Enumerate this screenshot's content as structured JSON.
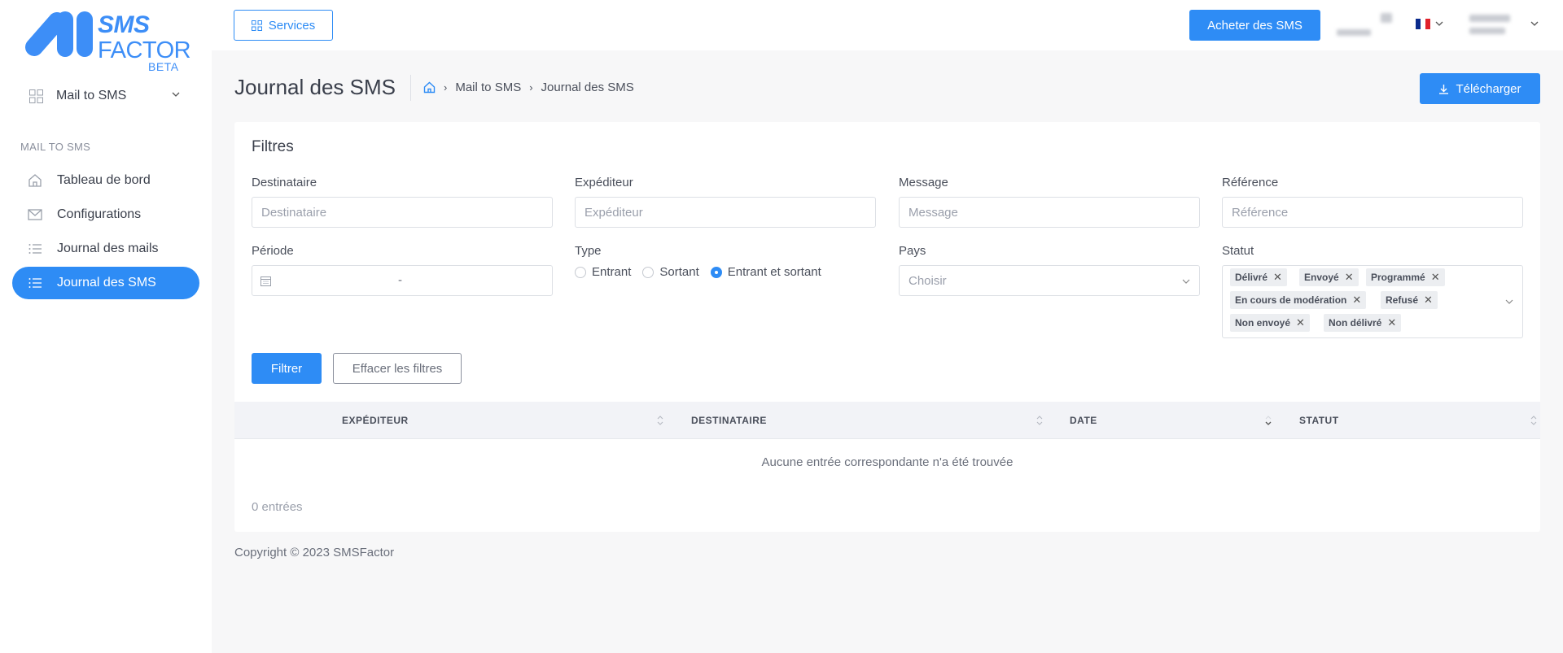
{
  "logo": {
    "line1": "SMS",
    "line2": "FACTOR",
    "line3": "BETA"
  },
  "sidebar": {
    "selector_label": "Mail to SMS",
    "section_label": "MAIL TO SMS",
    "items": [
      {
        "label": "Tableau de bord",
        "icon": "home-icon"
      },
      {
        "label": "Configurations",
        "icon": "envelope-icon"
      },
      {
        "label": "Journal des mails",
        "icon": "list-icon"
      },
      {
        "label": "Journal des SMS",
        "icon": "list-icon",
        "active": true
      }
    ]
  },
  "header": {
    "services_label": "Services",
    "buy_label": "Acheter des SMS",
    "language": "FR"
  },
  "page": {
    "title": "Journal des SMS",
    "breadcrumb": [
      "Mail to SMS",
      "Journal des SMS"
    ],
    "download_label": "Télécharger"
  },
  "filters": {
    "title": "Filtres",
    "destinataire": {
      "label": "Destinataire",
      "placeholder": "Destinataire"
    },
    "expediteur": {
      "label": "Expéditeur",
      "placeholder": "Expéditeur"
    },
    "message": {
      "label": "Message",
      "placeholder": "Message"
    },
    "reference": {
      "label": "Référence",
      "placeholder": "Référence"
    },
    "periode": {
      "label": "Période",
      "separator": "-"
    },
    "type": {
      "label": "Type",
      "options": [
        "Entrant",
        "Sortant",
        "Entrant et sortant"
      ],
      "selected": "Entrant et sortant"
    },
    "pays": {
      "label": "Pays",
      "placeholder": "Choisir"
    },
    "statut": {
      "label": "Statut",
      "tags": [
        "Délivré",
        "Envoyé",
        "Programmé",
        "En cours de modération",
        "Refusé",
        "Non envoyé",
        "Non délivré"
      ]
    },
    "filter_button": "Filtrer",
    "clear_button": "Effacer les filtres"
  },
  "table": {
    "columns": [
      "EXPÉDITEUR",
      "DESTINATAIRE",
      "DATE",
      "STATUT"
    ],
    "empty_message": "Aucune entrée correspondante n'a été trouvée",
    "count_text": "0 entrées"
  },
  "footer": {
    "copyright": "Copyright © 2023 SMSFactor"
  },
  "colors": {
    "accent": "#2e8cf5",
    "background": "#f7f7f8"
  }
}
